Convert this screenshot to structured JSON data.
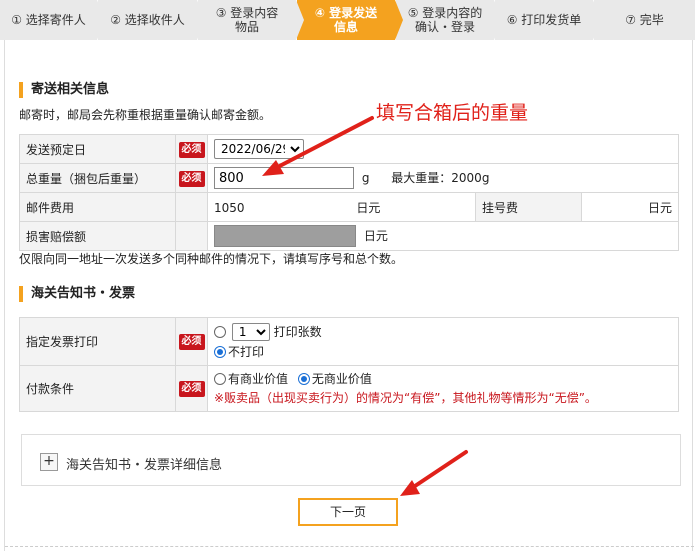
{
  "steps": [
    {
      "label": "① 选择寄件人",
      "active": false
    },
    {
      "label": "② 选择收件人",
      "active": false
    },
    {
      "label": "③ 登录内容\n物品",
      "active": false
    },
    {
      "label": "④ 登录发送\n信息",
      "active": true
    },
    {
      "label": "⑤ 登录内容的\n确认・登录",
      "active": false
    },
    {
      "label": "⑥ 打印发货单",
      "active": false
    },
    {
      "label": "⑦ 完毕",
      "active": false
    }
  ],
  "section1": {
    "title": "寄送相关信息",
    "note": "邮寄时，邮局会先称重根据重量确认邮寄金额。"
  },
  "annotation": "填写合箱后的重量",
  "required_badge": "必须",
  "rows": {
    "send_date": {
      "label": "发送预定日",
      "value": "2022/06/29"
    },
    "weight": {
      "label": "总重量（捆包后重量）",
      "value": "800",
      "unit": "g",
      "max": "最大重量：2000g"
    },
    "postage": {
      "label": "邮件费用",
      "value": "1050",
      "unit": "日元",
      "reg_label": "挂号费",
      "reg_unit": "日元"
    },
    "insurance": {
      "label": "损害赔偿额",
      "unit": "日元"
    }
  },
  "note2": "仅限向同一地址一次发送多个同种邮件的情况下，请填写序号和总个数。",
  "section2": {
    "title": "海关告知书・发票"
  },
  "invoice": {
    "label": "指定发票打印",
    "copies": "1",
    "copies_label": "打印张数",
    "no_print": "不打印"
  },
  "payment": {
    "label": "付款条件",
    "option1": "有商业价值",
    "option2": "无商业价值",
    "note": "※贩卖品（出现买卖行为）的情况为“有偿”，其他礼物等情形为“无偿”。"
  },
  "detail": {
    "plus": "+",
    "label": "海关告知书・发票详细信息"
  },
  "next_button": "下一页",
  "colors": {
    "accent": "#f4a21f",
    "required": "#c8161d",
    "annotation": "#e0211a"
  }
}
